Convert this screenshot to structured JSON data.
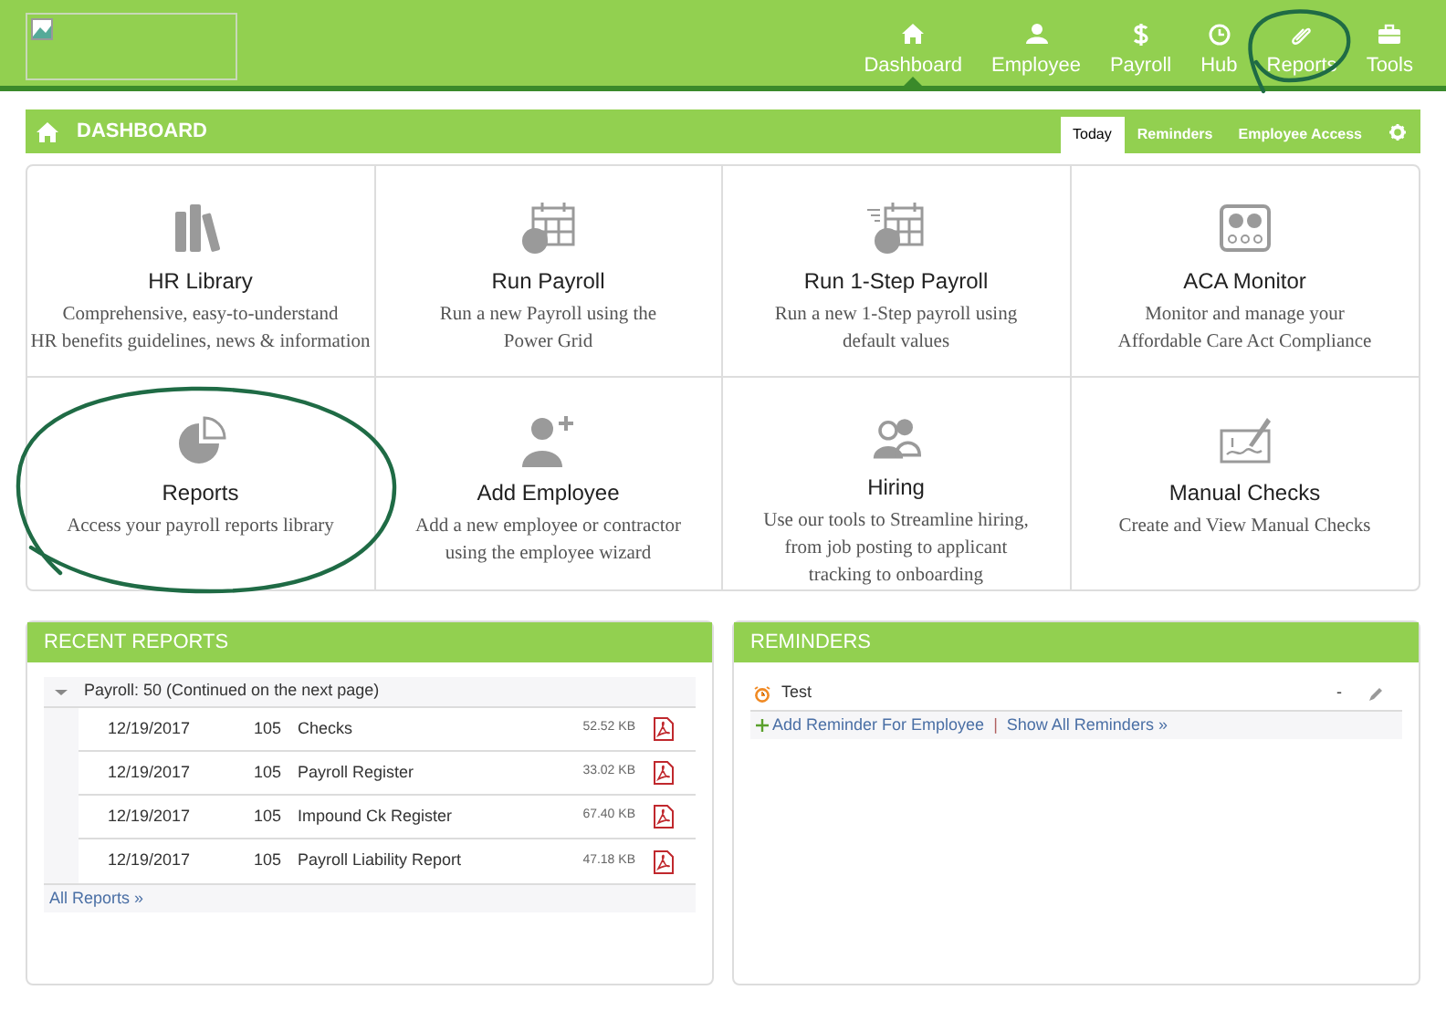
{
  "nav": {
    "items": [
      {
        "label": "Dashboard",
        "kind": "home",
        "selected": true
      },
      {
        "label": "Employee",
        "kind": "person",
        "selected": false
      },
      {
        "label": "Payroll",
        "kind": "dollar",
        "selected": false
      },
      {
        "label": "Hub",
        "kind": "clock",
        "selected": false
      },
      {
        "label": "Reports",
        "kind": "clip",
        "selected": false
      },
      {
        "label": "Tools",
        "kind": "briefcase",
        "selected": false
      }
    ]
  },
  "dashboard_bar": {
    "title": "DASHBOARD",
    "tabs": [
      {
        "label": "Today",
        "selected": true
      },
      {
        "label": "Reminders",
        "selected": false
      },
      {
        "label": "Employee Access",
        "selected": false
      }
    ]
  },
  "tiles": [
    {
      "kind": "books",
      "title": "HR Library",
      "lines": [
        "Comprehensive, easy-to-understand",
        "HR benefits guidelines, news & information"
      ]
    },
    {
      "kind": "calendar",
      "title": "Run Payroll",
      "lines": [
        "Run a new Payroll using the",
        "Power Grid"
      ]
    },
    {
      "kind": "fast-calendar",
      "title": "Run 1-Step Payroll",
      "lines": [
        "Run a new 1-Step payroll using",
        "default values"
      ]
    },
    {
      "kind": "gauges",
      "title": "ACA Monitor",
      "lines": [
        "Monitor and manage your",
        "Affordable Care Act Compliance"
      ]
    },
    {
      "kind": "pie",
      "title": "Reports",
      "lines": [
        "Access your payroll reports library"
      ]
    },
    {
      "kind": "add-person",
      "title": "Add Employee",
      "lines": [
        "Add a new employee or contractor",
        "using the employee wizard"
      ]
    },
    {
      "kind": "people",
      "title": "Hiring",
      "lines": [
        "Use our tools to Streamline hiring,",
        "from job posting to applicant",
        "tracking to onboarding"
      ]
    },
    {
      "kind": "check",
      "title": "Manual Checks",
      "lines": [
        "Create and View Manual Checks"
      ]
    }
  ],
  "recent_reports": {
    "title": "RECENT REPORTS",
    "group": {
      "label": "Payroll: 50 (Continued on the next page)",
      "expanded": true
    },
    "rows": [
      {
        "date": "12/19/2017",
        "number": "105",
        "name": "Checks",
        "size": "52.52 KB"
      },
      {
        "date": "12/19/2017",
        "number": "105",
        "name": "Payroll Register",
        "size": "33.02 KB"
      },
      {
        "date": "12/19/2017",
        "number": "105",
        "name": "Impound Ck Register",
        "size": "67.40 KB"
      },
      {
        "date": "12/19/2017",
        "number": "105",
        "name": "Payroll Liability Report",
        "size": "47.18 KB"
      }
    ],
    "link": "All Reports »"
  },
  "reminders": {
    "title": "REMINDERS",
    "items": [
      {
        "label": "Test",
        "value": "-"
      }
    ],
    "add_link": "Add Reminder For Employee",
    "separator": "|",
    "show_link": "Show All Reminders »"
  }
}
